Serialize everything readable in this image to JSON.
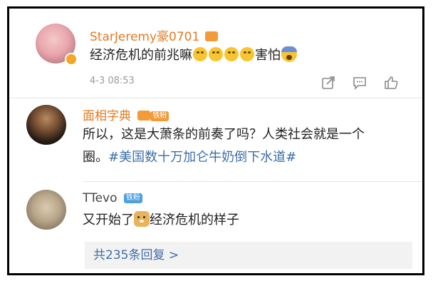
{
  "comments": [
    {
      "user": "StarJeremy豪0701",
      "text_prefix": "经济危机的前兆嘛",
      "text_suffix": "害怕",
      "time": "4-3 08:53"
    },
    {
      "user": "面相字典",
      "badge": "铁粉",
      "line1": "所以，这是大萧条的前奏了吗？人类社会就是一个",
      "line2_text": "圈。",
      "line2_tag": "#美国数十万加仑牛奶倒下水道#"
    },
    {
      "user": "TTevo",
      "badge": "铁粉",
      "text_prefix": "又开始了",
      "text_suffix": "经济危机的样子"
    }
  ],
  "replies_link": "共235条回复 >",
  "colors": {
    "username": "#e57a1f",
    "link": "#3d6ea8",
    "badge_orange": "#f29b38",
    "badge_blue": "#4d9fe0",
    "frame": "#000000"
  },
  "icons": [
    "share-icon",
    "comment-icon",
    "like-icon",
    "crown-badge-icon",
    "emoji-cry-laugh",
    "emoji-scared",
    "emoji-doge"
  ]
}
